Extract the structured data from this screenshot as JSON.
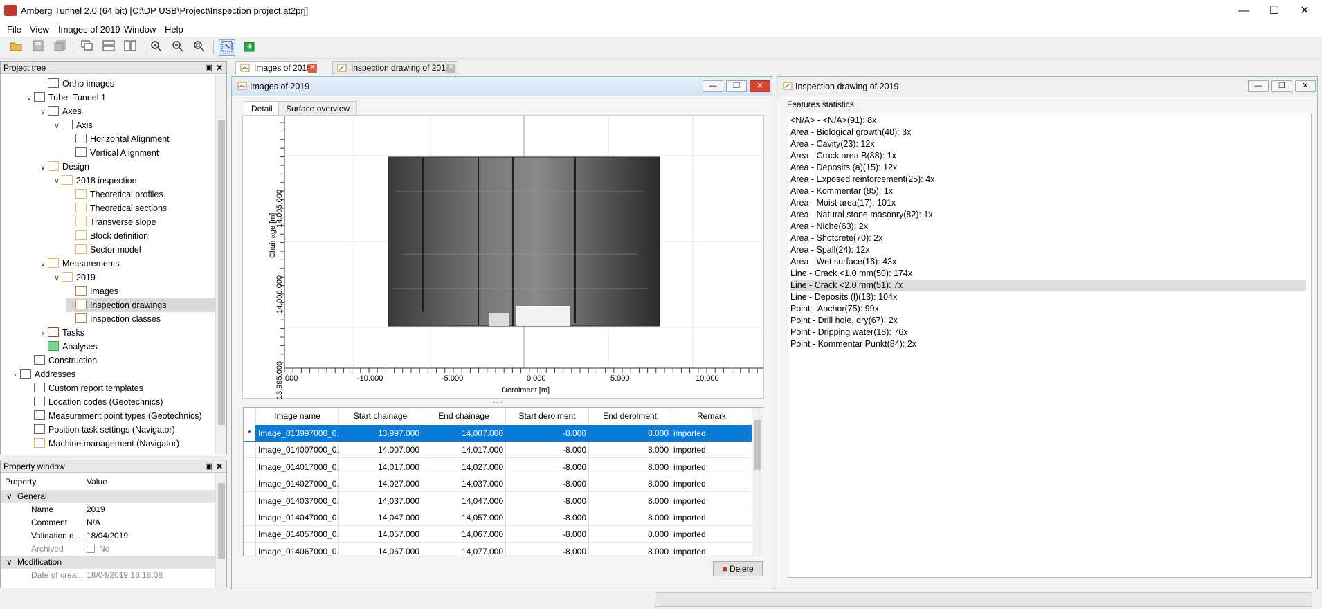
{
  "window": {
    "title": "Amberg Tunnel 2.0 (64 bit) [C:\\DP USB\\Project\\Inspection project.at2prj]",
    "controls": {
      "minimize": "—",
      "maximize": "☐",
      "close": "✕"
    }
  },
  "menu": {
    "file": "File",
    "view": "View",
    "images": "Images of 2019",
    "window": "Window",
    "help": "Help"
  },
  "toolbar": {
    "icons": [
      "open-folder-icon",
      "save-icon",
      "save-all-icon",
      "cascade-icon",
      "tile-horizontal-icon",
      "tile-vertical-icon",
      "zoom-in-icon",
      "zoom-out-icon",
      "zoom-fit-icon",
      "pan-select-icon",
      "export-icon"
    ]
  },
  "project_tree": {
    "title": "Project tree",
    "items": [
      {
        "label": "Ortho images"
      },
      {
        "label": "Tube: Tunnel 1"
      },
      {
        "label": "Axes"
      },
      {
        "label": "Axis"
      },
      {
        "label": "Horizontal Alignment"
      },
      {
        "label": "Vertical Alignment"
      },
      {
        "label": "Design"
      },
      {
        "label": "2018 inspection"
      },
      {
        "label": "Theoretical profiles"
      },
      {
        "label": "Theoretical sections"
      },
      {
        "label": "Transverse slope"
      },
      {
        "label": "Block definition"
      },
      {
        "label": "Sector model"
      },
      {
        "label": "Measurements"
      },
      {
        "label": "2019"
      },
      {
        "label": "Images"
      },
      {
        "label": "Inspection drawings"
      },
      {
        "label": "Inspection classes"
      },
      {
        "label": "Tasks"
      },
      {
        "label": "Analyses"
      },
      {
        "label": "Construction"
      },
      {
        "label": "Addresses"
      },
      {
        "label": "Custom report templates"
      },
      {
        "label": "Location codes (Geotechnics)"
      },
      {
        "label": "Measurement point types (Geotechnics)"
      },
      {
        "label": "Position task settings (Navigator)"
      },
      {
        "label": "Machine management (Navigator)"
      }
    ],
    "selected": "Inspection drawings"
  },
  "property_window": {
    "title": "Property window",
    "col_property": "Property",
    "col_value": "Value",
    "section_general": "General",
    "rows": [
      {
        "key": "Name",
        "value": "2019"
      },
      {
        "key": "Comment",
        "value": "N/A"
      },
      {
        "key": "Validation d...",
        "value": "18/04/2019"
      },
      {
        "key": "Archived",
        "value": "No"
      }
    ],
    "section_modification": "Modification",
    "mod_rows": [
      {
        "key": "Date of crea...",
        "value": "18/04/2019 16:18:08"
      }
    ]
  },
  "tabs": {
    "images": "Images of 2019",
    "inspection": "Inspection drawing of 2019"
  },
  "images_window": {
    "title": "Images of 2019",
    "subtabs": {
      "detail": "Detail",
      "surface": "Surface overview"
    },
    "plot": {
      "ylabel": "Chainage [m]",
      "xlabel": "Derolment [m]",
      "y_ticks": [
        "14,005.000",
        "14,000.000",
        "13,995.000"
      ],
      "x_ticks": [
        "000",
        "-10.000",
        "-5.000",
        "0.000",
        "5.000",
        "10.000"
      ]
    },
    "splitter": "- - -",
    "table": {
      "columns": [
        "Image name",
        "Start chainage",
        "End chainage",
        "Start derolment",
        "End derolment",
        "Remark"
      ],
      "rows": [
        [
          "Image_013997000_0...",
          "13,997.000",
          "14,007.000",
          "-8.000",
          "8.000",
          "imported"
        ],
        [
          "Image_014007000_0...",
          "14,007.000",
          "14,017.000",
          "-8.000",
          "8.000",
          "imported"
        ],
        [
          "Image_014017000_0...",
          "14,017.000",
          "14,027.000",
          "-8.000",
          "8.000",
          "imported"
        ],
        [
          "Image_014027000_0...",
          "14,027.000",
          "14,037.000",
          "-8.000",
          "8.000",
          "imported"
        ],
        [
          "Image_014037000_0...",
          "14,037.000",
          "14,047.000",
          "-8.000",
          "8.000",
          "imported"
        ],
        [
          "Image_014047000_0...",
          "14,047.000",
          "14,057.000",
          "-8.000",
          "8.000",
          "imported"
        ],
        [
          "Image_014057000_0...",
          "14,057.000",
          "14,067.000",
          "-8.000",
          "8.000",
          "imported"
        ],
        [
          "Image_014067000_0...",
          "14,067.000",
          "14,077.000",
          "-8.000",
          "8.000",
          "imported"
        ]
      ],
      "row_marker": "*"
    },
    "delete_label": "Delete"
  },
  "inspection_window": {
    "title": "Inspection drawing of 2019",
    "stats_label": "Features statistics:",
    "stats": [
      "<N/A> - <N/A>(91): 8x",
      "Area - Biological growth(40): 3x",
      "Area - Cavity(23): 12x",
      "Area - Crack area B(88): 1x",
      "Area - Deposits (a)(15): 12x",
      "Area - Exposed reinforcement(25): 4x",
      "Area - Kommentar (85): 1x",
      "Area - Moist area(17): 101x",
      "Area - Natural stone masonry(82): 1x",
      "Area - Niche(63): 2x",
      "Area - Shotcrete(70): 2x",
      "Area - Spall(24): 12x",
      "Area - Wet surface(16): 43x",
      "Line - Crack <1.0 mm(50): 174x",
      "Line - Crack <2.0 mm(51): 7x",
      "Line - Deposits (l)(13): 104x",
      "Point - Anchor(75): 99x",
      "Point - Drill hole, dry(67): 2x",
      "Point - Dripping water(18): 76x",
      "Point - Kommentar Punkt(84): 2x"
    ],
    "highlighted_stat": "Line - Crack <2.0 mm(51): 7x"
  },
  "colors": {
    "selection": "#0a7ad7",
    "accent": "#c0392b"
  }
}
